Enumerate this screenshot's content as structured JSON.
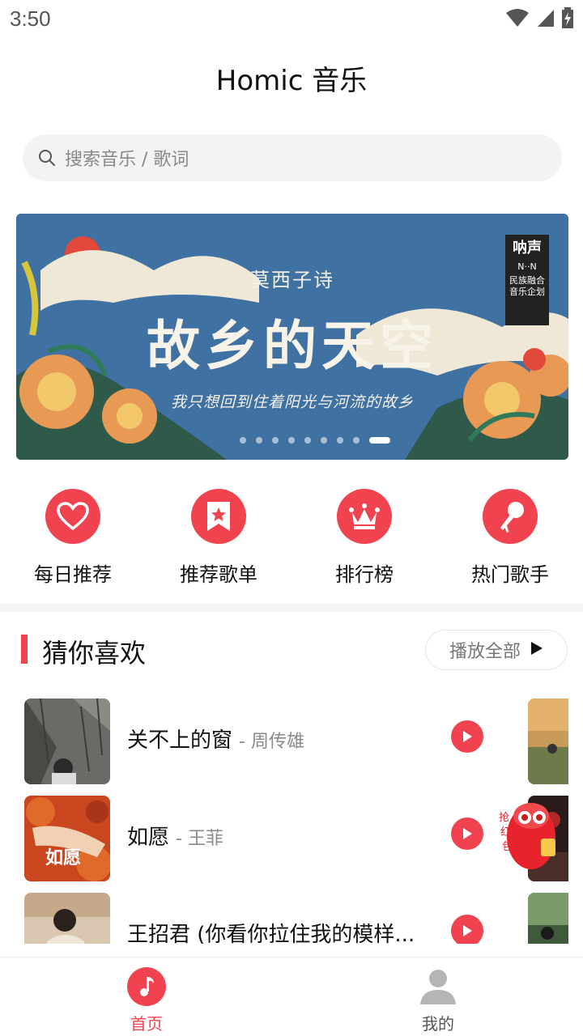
{
  "status_bar": {
    "time": "3:50"
  },
  "app": {
    "title": "Homic 音乐"
  },
  "search": {
    "placeholder": "搜索音乐 / 歌词"
  },
  "banner": {
    "subtitle": "莫西子诗",
    "title": "故乡的天空",
    "caption": "我只想回到住着阳光与河流的故乡",
    "badge_title": "呐声",
    "badge_mark": "N··N",
    "badge_line1": "民族融合",
    "badge_line2": "音乐企划",
    "dot_count": 9,
    "active_dot": 9
  },
  "quick_nav": [
    {
      "label": "每日推荐",
      "icon": "heart-icon"
    },
    {
      "label": "推荐歌单",
      "icon": "bookmark-star-icon"
    },
    {
      "label": "排行榜",
      "icon": "crown-icon"
    },
    {
      "label": "热门歌手",
      "icon": "microphone-icon"
    }
  ],
  "recommend": {
    "title": "猜你喜欢",
    "play_all_label": "播放全部"
  },
  "songs": [
    {
      "title": "关不上的窗",
      "artist": "- 周传雄"
    },
    {
      "title": "如愿",
      "artist": "- 王菲"
    },
    {
      "title": "王招君 (你看你拉住我的模样...",
      "artist": ""
    }
  ],
  "tab_bar": {
    "items": [
      {
        "label": "首页",
        "icon": "music-note-icon",
        "active": true
      },
      {
        "label": "我的",
        "icon": "user-icon",
        "active": false
      }
    ]
  },
  "colors": {
    "accent": "#f0434f",
    "banner_bg": "#3f71a3",
    "muted_text": "#8a8a8a"
  }
}
